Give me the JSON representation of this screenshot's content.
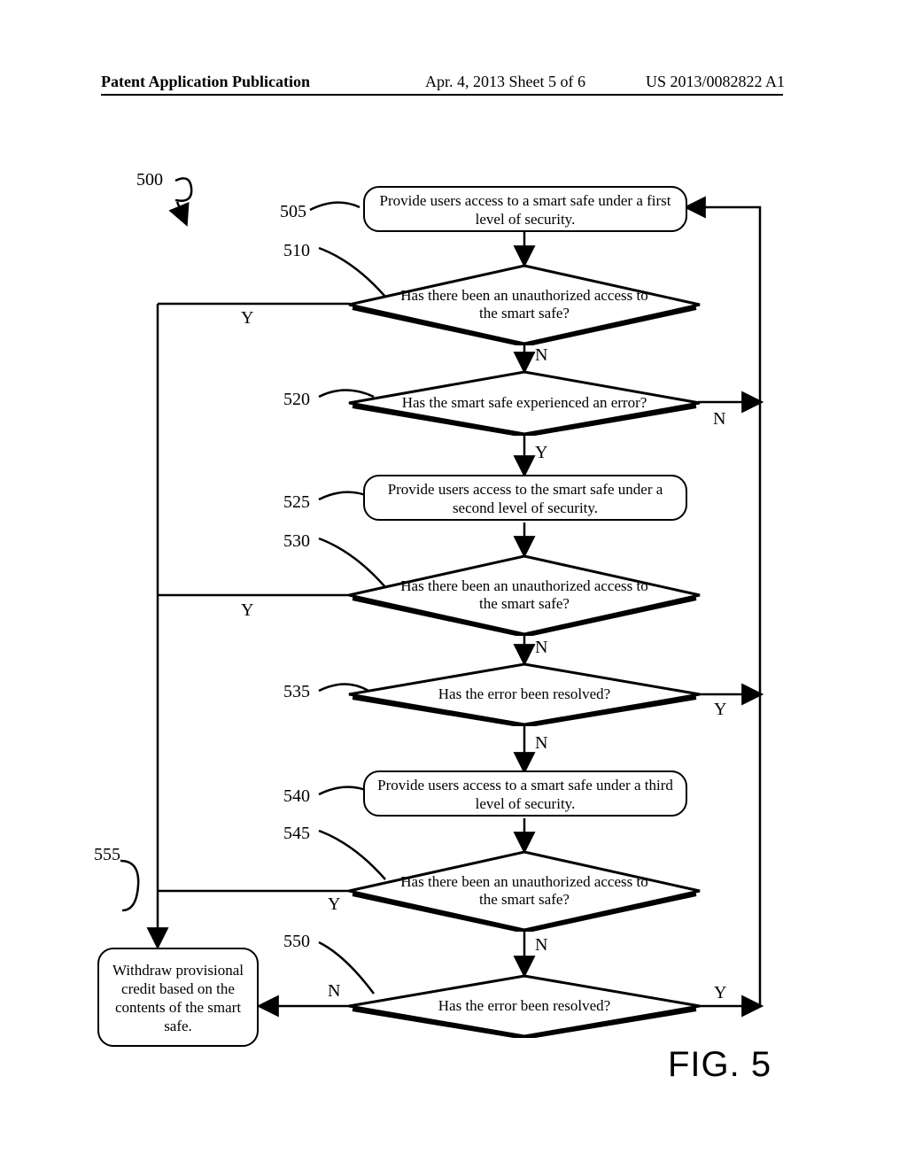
{
  "header": {
    "left": "Patent Application Publication",
    "mid": "Apr. 4, 2013  Sheet 5 of 6",
    "right": "US 2013/0082822 A1"
  },
  "refs": {
    "r500": "500",
    "r505": "505",
    "r510": "510",
    "r520": "520",
    "r525": "525",
    "r530": "530",
    "r535": "535",
    "r540": "540",
    "r545": "545",
    "r550": "550",
    "r555": "555"
  },
  "boxes": {
    "b505": "Provide users access to a smart safe under a first level of security.",
    "b525": "Provide users access to the smart safe under a second level of security.",
    "b540": "Provide users access to a smart safe under a third level of security.",
    "b555": "Withdraw provisional credit based on the contents of the smart safe."
  },
  "diamonds": {
    "d510": "Has there been an unauthorized access to the smart safe?",
    "d520": "Has the smart safe experienced an error?",
    "d535": "Has the error been resolved?",
    "d550": "Has the error been resolved?"
  },
  "edges": {
    "y": "Y",
    "n": "N"
  },
  "figure": "FIG. 5"
}
